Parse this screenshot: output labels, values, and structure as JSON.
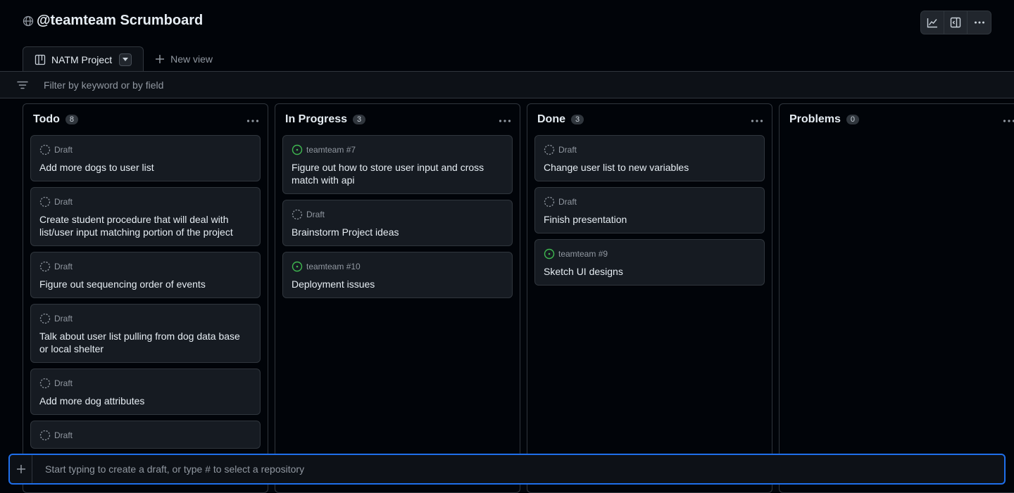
{
  "project": {
    "title": "@teamteam Scrumboard"
  },
  "toolbar": {
    "icons": [
      "chart-icon",
      "sidebar-icon",
      "more-icon"
    ]
  },
  "tabs": [
    {
      "label": "NATM Project",
      "icon": "board-icon",
      "active": true
    }
  ],
  "new_view_label": "New view",
  "filter": {
    "placeholder": "Filter by keyword or by field"
  },
  "columns": [
    {
      "name": "Todo",
      "count": "8",
      "cards": [
        {
          "meta": "Draft",
          "type": "draft",
          "title": "Add more dogs to user list"
        },
        {
          "meta": "Draft",
          "type": "draft",
          "title": "Create student procedure that will deal with list/user input matching portion of the project"
        },
        {
          "meta": "Draft",
          "type": "draft",
          "title": "Figure out sequencing order of events"
        },
        {
          "meta": "Draft",
          "type": "draft",
          "title": "Talk about user list pulling from dog data base or local shelter"
        },
        {
          "meta": "Draft",
          "type": "draft",
          "title": "Add more dog attributes"
        },
        {
          "meta": "Draft",
          "type": "draft",
          "title": ""
        }
      ]
    },
    {
      "name": "In Progress",
      "count": "3",
      "cards": [
        {
          "meta": "teamteam #7",
          "type": "issue",
          "title": "Figure out how to store user input and cross match with api"
        },
        {
          "meta": "Draft",
          "type": "draft",
          "title": "Brainstorm Project ideas"
        },
        {
          "meta": "teamteam #10",
          "type": "issue",
          "title": "Deployment issues"
        }
      ]
    },
    {
      "name": "Done",
      "count": "3",
      "cards": [
        {
          "meta": "Draft",
          "type": "draft",
          "title": "Change user list to new variables"
        },
        {
          "meta": "Draft",
          "type": "draft",
          "title": "Finish presentation"
        },
        {
          "meta": "teamteam #9",
          "type": "issue",
          "title": "Sketch UI designs"
        }
      ]
    },
    {
      "name": "Problems",
      "count": "0",
      "cards": []
    }
  ],
  "draft_bar": {
    "placeholder": "Start typing to create a draft, or type # to select a repository"
  },
  "colors": {
    "accent": "#1f6feb",
    "issue_open": "#3fb950",
    "background": "#010409",
    "card": "#161b22",
    "border": "#30363d"
  }
}
